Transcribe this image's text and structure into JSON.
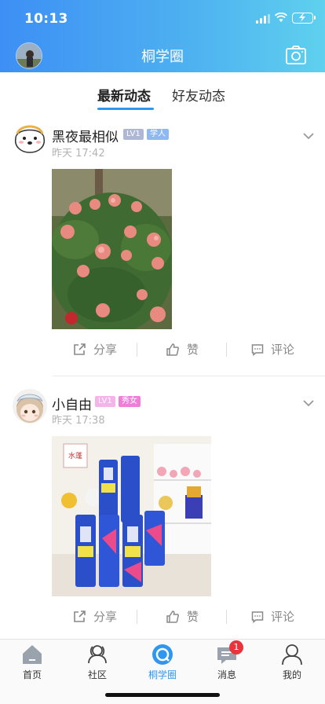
{
  "status_bar": {
    "time": "10:13"
  },
  "header": {
    "title": "桐学圈"
  },
  "tabs": [
    {
      "label": "最新动态",
      "active": true
    },
    {
      "label": "好友动态",
      "active": false
    }
  ],
  "posts": [
    {
      "username": "黑夜最相似",
      "level": "LV1",
      "tag": "学人",
      "time": "昨天 17:42",
      "image_desc_icon": "rose-bush-photo"
    },
    {
      "username": "小自由",
      "level": "LV1",
      "tag": "秀女",
      "time": "昨天 17:38",
      "image_desc_icon": "beer-cans-photo"
    }
  ],
  "actions": {
    "share": "分享",
    "like": "赞",
    "comment": "评论"
  },
  "tabbar": [
    {
      "label": "首页",
      "icon": "home-icon",
      "active": false
    },
    {
      "label": "社区",
      "icon": "community-icon",
      "active": false
    },
    {
      "label": "桐学圈",
      "icon": "circle-icon",
      "active": true
    },
    {
      "label": "消息",
      "icon": "message-icon",
      "active": false,
      "badge": "1"
    },
    {
      "label": "我的",
      "icon": "profile-icon",
      "active": false
    }
  ],
  "colors": {
    "accent": "#2f97f2",
    "header_start": "#3d8ff5",
    "header_end": "#5fd1ee",
    "badge_red": "#e8353b"
  }
}
